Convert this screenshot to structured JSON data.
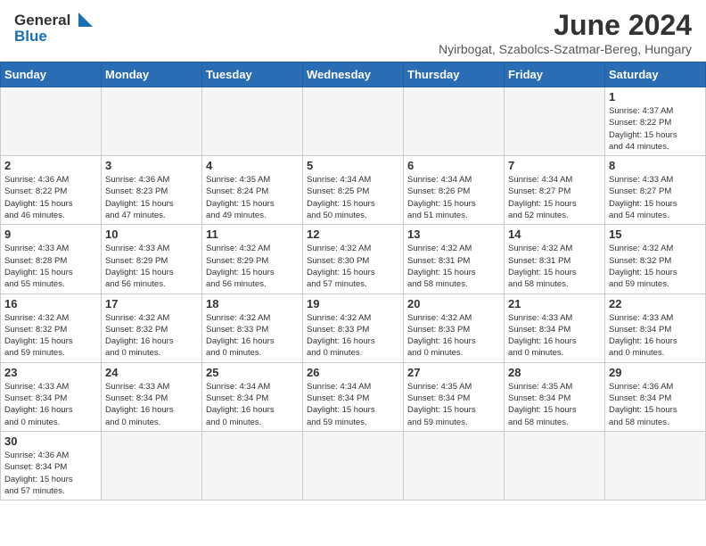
{
  "header": {
    "logo_general": "General",
    "logo_blue": "Blue",
    "month_title": "June 2024",
    "subtitle": "Nyirbogat, Szabolcs-Szatmar-Bereg, Hungary"
  },
  "days_of_week": [
    "Sunday",
    "Monday",
    "Tuesday",
    "Wednesday",
    "Thursday",
    "Friday",
    "Saturday"
  ],
  "weeks": [
    {
      "days": [
        {
          "num": "",
          "info": ""
        },
        {
          "num": "",
          "info": ""
        },
        {
          "num": "",
          "info": ""
        },
        {
          "num": "",
          "info": ""
        },
        {
          "num": "",
          "info": ""
        },
        {
          "num": "",
          "info": ""
        },
        {
          "num": "1",
          "info": "Sunrise: 4:37 AM\nSunset: 8:22 PM\nDaylight: 15 hours\nand 44 minutes."
        }
      ]
    },
    {
      "days": [
        {
          "num": "2",
          "info": "Sunrise: 4:36 AM\nSunset: 8:22 PM\nDaylight: 15 hours\nand 46 minutes."
        },
        {
          "num": "3",
          "info": "Sunrise: 4:36 AM\nSunset: 8:23 PM\nDaylight: 15 hours\nand 47 minutes."
        },
        {
          "num": "4",
          "info": "Sunrise: 4:35 AM\nSunset: 8:24 PM\nDaylight: 15 hours\nand 49 minutes."
        },
        {
          "num": "5",
          "info": "Sunrise: 4:34 AM\nSunset: 8:25 PM\nDaylight: 15 hours\nand 50 minutes."
        },
        {
          "num": "6",
          "info": "Sunrise: 4:34 AM\nSunset: 8:26 PM\nDaylight: 15 hours\nand 51 minutes."
        },
        {
          "num": "7",
          "info": "Sunrise: 4:34 AM\nSunset: 8:27 PM\nDaylight: 15 hours\nand 52 minutes."
        },
        {
          "num": "8",
          "info": "Sunrise: 4:33 AM\nSunset: 8:27 PM\nDaylight: 15 hours\nand 54 minutes."
        }
      ]
    },
    {
      "days": [
        {
          "num": "9",
          "info": "Sunrise: 4:33 AM\nSunset: 8:28 PM\nDaylight: 15 hours\nand 55 minutes."
        },
        {
          "num": "10",
          "info": "Sunrise: 4:33 AM\nSunset: 8:29 PM\nDaylight: 15 hours\nand 56 minutes."
        },
        {
          "num": "11",
          "info": "Sunrise: 4:32 AM\nSunset: 8:29 PM\nDaylight: 15 hours\nand 56 minutes."
        },
        {
          "num": "12",
          "info": "Sunrise: 4:32 AM\nSunset: 8:30 PM\nDaylight: 15 hours\nand 57 minutes."
        },
        {
          "num": "13",
          "info": "Sunrise: 4:32 AM\nSunset: 8:31 PM\nDaylight: 15 hours\nand 58 minutes."
        },
        {
          "num": "14",
          "info": "Sunrise: 4:32 AM\nSunset: 8:31 PM\nDaylight: 15 hours\nand 58 minutes."
        },
        {
          "num": "15",
          "info": "Sunrise: 4:32 AM\nSunset: 8:32 PM\nDaylight: 15 hours\nand 59 minutes."
        }
      ]
    },
    {
      "days": [
        {
          "num": "16",
          "info": "Sunrise: 4:32 AM\nSunset: 8:32 PM\nDaylight: 15 hours\nand 59 minutes."
        },
        {
          "num": "17",
          "info": "Sunrise: 4:32 AM\nSunset: 8:32 PM\nDaylight: 16 hours\nand 0 minutes."
        },
        {
          "num": "18",
          "info": "Sunrise: 4:32 AM\nSunset: 8:33 PM\nDaylight: 16 hours\nand 0 minutes."
        },
        {
          "num": "19",
          "info": "Sunrise: 4:32 AM\nSunset: 8:33 PM\nDaylight: 16 hours\nand 0 minutes."
        },
        {
          "num": "20",
          "info": "Sunrise: 4:32 AM\nSunset: 8:33 PM\nDaylight: 16 hours\nand 0 minutes."
        },
        {
          "num": "21",
          "info": "Sunrise: 4:33 AM\nSunset: 8:34 PM\nDaylight: 16 hours\nand 0 minutes."
        },
        {
          "num": "22",
          "info": "Sunrise: 4:33 AM\nSunset: 8:34 PM\nDaylight: 16 hours\nand 0 minutes."
        }
      ]
    },
    {
      "days": [
        {
          "num": "23",
          "info": "Sunrise: 4:33 AM\nSunset: 8:34 PM\nDaylight: 16 hours\nand 0 minutes."
        },
        {
          "num": "24",
          "info": "Sunrise: 4:33 AM\nSunset: 8:34 PM\nDaylight: 16 hours\nand 0 minutes."
        },
        {
          "num": "25",
          "info": "Sunrise: 4:34 AM\nSunset: 8:34 PM\nDaylight: 16 hours\nand 0 minutes."
        },
        {
          "num": "26",
          "info": "Sunrise: 4:34 AM\nSunset: 8:34 PM\nDaylight: 15 hours\nand 59 minutes."
        },
        {
          "num": "27",
          "info": "Sunrise: 4:35 AM\nSunset: 8:34 PM\nDaylight: 15 hours\nand 59 minutes."
        },
        {
          "num": "28",
          "info": "Sunrise: 4:35 AM\nSunset: 8:34 PM\nDaylight: 15 hours\nand 58 minutes."
        },
        {
          "num": "29",
          "info": "Sunrise: 4:36 AM\nSunset: 8:34 PM\nDaylight: 15 hours\nand 58 minutes."
        }
      ]
    },
    {
      "days": [
        {
          "num": "30",
          "info": "Sunrise: 4:36 AM\nSunset: 8:34 PM\nDaylight: 15 hours\nand 57 minutes."
        },
        {
          "num": "",
          "info": ""
        },
        {
          "num": "",
          "info": ""
        },
        {
          "num": "",
          "info": ""
        },
        {
          "num": "",
          "info": ""
        },
        {
          "num": "",
          "info": ""
        },
        {
          "num": "",
          "info": ""
        }
      ]
    }
  ]
}
